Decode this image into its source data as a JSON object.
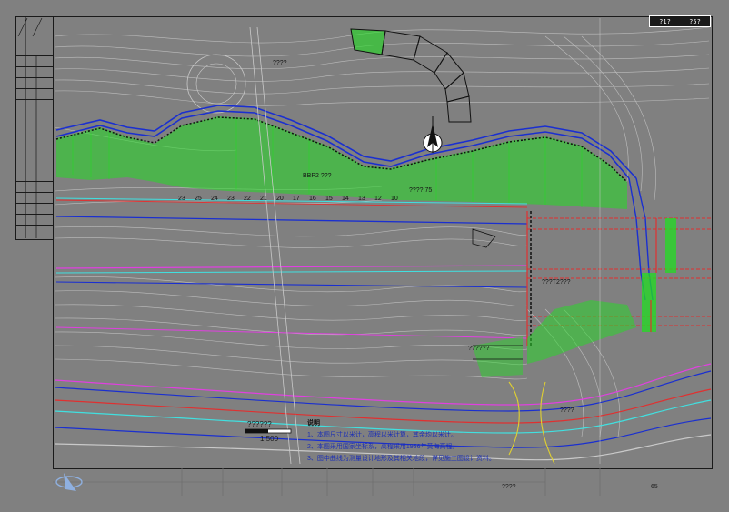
{
  "sheet_number": {
    "left": "?1?",
    "right": "?5?"
  },
  "scale": {
    "title": "??????",
    "ratio": "1:500"
  },
  "notes": {
    "title": "说明",
    "lines": [
      "1、本图尺寸以米计，高程以米计算，其余均以米计。",
      "2、本图采用国家坐标系，高程采用1956年黄海高程。",
      "3、图中曲线为测量设计地形及其相关地段，详见施工图设计资料。"
    ]
  },
  "station_numbers": [
    "23",
    "25",
    "24",
    "23",
    "22",
    "21",
    "20",
    "17",
    "16",
    "15",
    "14",
    "13",
    "12",
    "10"
  ],
  "plan_labels": {
    "top_note": "????",
    "mid_note": "BBP2 ???",
    "right_note": "???T2???",
    "elevation": "???? 75",
    "lower_note": "??????",
    "box_label": "????"
  },
  "bottom_codes": {
    "center": "????",
    "right": "65"
  },
  "colors": {
    "background": "#808080",
    "green_fill": "#22dd22",
    "blue_line": "#1a2fd0",
    "red_line": "#e03030",
    "magenta_line": "#e040e0",
    "cyan_line": "#40e0e0",
    "contour": "#c9c9c9",
    "yellow_line": "#e0d030"
  },
  "icons": {
    "north_arrow": "north-arrow-icon",
    "logo": "company-logo-icon"
  }
}
